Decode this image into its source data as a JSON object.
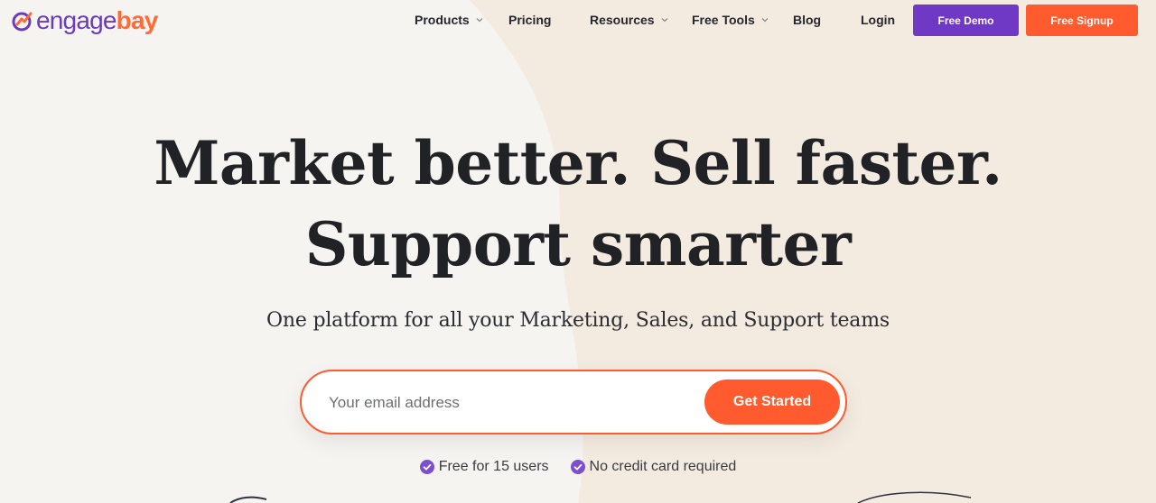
{
  "logo": {
    "text_part1": "engage",
    "text_part2": "bay",
    "mark_icon": "engagebay-logo-mark"
  },
  "nav": {
    "items": [
      {
        "label": "Products",
        "dropdown": true
      },
      {
        "label": "Pricing",
        "dropdown": false
      },
      {
        "label": "Resources",
        "dropdown": true
      },
      {
        "label": "Free Tools",
        "dropdown": true
      },
      {
        "label": "Blog",
        "dropdown": false
      },
      {
        "label": "Login",
        "dropdown": false
      }
    ],
    "demo_label": "Free Demo",
    "signup_label": "Free Signup"
  },
  "hero": {
    "title_line1": "Market better. Sell faster.",
    "title_line2": "Support smarter",
    "subtitle": "One platform for all your Marketing, Sales, and Support teams",
    "email_placeholder": "Your email address",
    "cta_label": "Get Started",
    "perks": [
      {
        "icon": "check-circle-icon",
        "label": "Free for 15 users"
      },
      {
        "icon": "check-circle-icon",
        "label": "No credit card required"
      }
    ]
  },
  "colors": {
    "brand_purple": "#6f38c5",
    "brand_orange": "#ff5b2e",
    "background": "#f6f4f1",
    "background_warm": "#f4ebe0"
  }
}
